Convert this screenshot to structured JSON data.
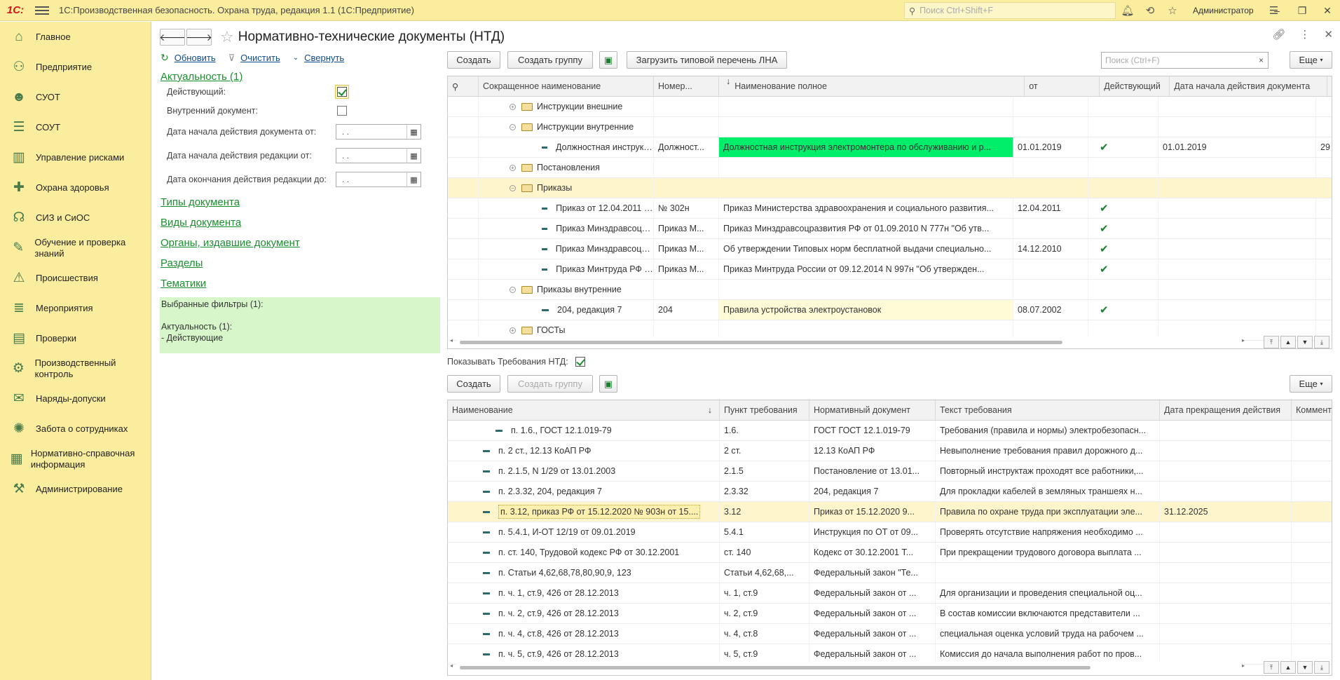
{
  "app": {
    "logo": "1С:",
    "title": "1С:Производственная безопасность. Охрана труда, редакция 1.1  (1С:Предприятие)",
    "search_placeholder": "Поиск Ctrl+Shift+F",
    "user": "Администратор"
  },
  "sidebar": {
    "items": [
      {
        "label": "Главное",
        "icon": "home-icon"
      },
      {
        "label": "Предприятие",
        "icon": "org-icon"
      },
      {
        "label": "СУОТ",
        "icon": "worker-icon"
      },
      {
        "label": "СОУТ",
        "icon": "checklist-icon"
      },
      {
        "label": "Управление рисками",
        "icon": "chart-icon"
      },
      {
        "label": "Охрана здоровья",
        "icon": "cross-icon"
      },
      {
        "label": "СИЗ и СиОС",
        "icon": "headset-icon"
      },
      {
        "label": "Обучение и проверка знаний",
        "icon": "training-icon"
      },
      {
        "label": "Происшествия",
        "icon": "warning-icon"
      },
      {
        "label": "Мероприятия",
        "icon": "list-icon"
      },
      {
        "label": "Проверки",
        "icon": "clipboard-icon"
      },
      {
        "label": "Производственный контроль",
        "icon": "control-icon"
      },
      {
        "label": "Наряды-допуски",
        "icon": "permit-icon"
      },
      {
        "label": "Забота о сотрудниках",
        "icon": "gear-icon"
      },
      {
        "label": "Нормативно-справочная информация",
        "icon": "books-icon"
      },
      {
        "label": "Администрирование",
        "icon": "admin-icon"
      }
    ]
  },
  "page": {
    "title": "Нормативно-технические документы (НТД)"
  },
  "filters": {
    "refresh": "Обновить",
    "clear": "Очистить",
    "collapse": "Свернуть",
    "actuality": "Актуальность (1)",
    "active_label": "Действующий:",
    "internal_label": "Внутренний документ:",
    "date_doc_start": "Дата начала действия документа от:",
    "date_red_start": "Дата начала действия редакции от:",
    "date_red_end": "Дата окончания действия редакции до:",
    "date_placeholder": " .  .",
    "groups": [
      "Типы документа",
      "Виды документа",
      "Органы, издавшие документ",
      "Разделы",
      "Тематики"
    ],
    "selected_title": "Выбранные фильтры (1):",
    "selected_group": "Актуальность (1):",
    "selected_value": "- Действующие"
  },
  "toolbar1": {
    "create": "Создать",
    "create_group": "Создать группу",
    "load": "Загрузить типовой перечень ЛНА",
    "search_placeholder": "Поиск (Ctrl+F)",
    "clear": "×",
    "more": "Еще"
  },
  "docs_table": {
    "headers": [
      "Сокращенное наименование",
      "Номер...",
      "Наименование полное",
      "от",
      "Действующий",
      "Дата начала действия документа",
      "Да"
    ],
    "rows": [
      {
        "type": "group",
        "expanded": false,
        "level": 1,
        "name": "Инструкции внешние",
        "num": "",
        "full": "",
        "date": "",
        "active": "",
        "start": "",
        "extra": ""
      },
      {
        "type": "group",
        "expanded": true,
        "level": 1,
        "name": "Инструкции внутренние",
        "num": "",
        "full": "",
        "date": "",
        "active": "",
        "start": "",
        "extra": ""
      },
      {
        "type": "item",
        "level": 2,
        "name": "Должностная инструкция эл...",
        "num": "Должност...",
        "full": "Должностная инструкция электромонтера по обслуживанию и р...",
        "date": "01.01.2019",
        "active": "✔",
        "start": "01.01.2019",
        "extra": "29",
        "fullcolor": "green"
      },
      {
        "type": "group",
        "expanded": false,
        "level": 1,
        "name": "Постановления",
        "num": "",
        "full": "",
        "date": "",
        "active": "",
        "start": "",
        "extra": ""
      },
      {
        "type": "group",
        "expanded": true,
        "level": 1,
        "name": "Приказы",
        "num": "",
        "full": "",
        "date": "",
        "active": "",
        "start": "",
        "extra": "",
        "selected": true
      },
      {
        "type": "item",
        "level": 2,
        "name": "Приказ от 12.04.2011 № 302н",
        "num": "№ 302н",
        "full": "Приказ Министерства здравоохранения и социального развития...",
        "date": "12.04.2011",
        "active": "✔",
        "start": "",
        "extra": ""
      },
      {
        "type": "item",
        "level": 2,
        "name": " Приказ Минздравсоцразвит...",
        "num": "Приказ М...",
        "full": "Приказ Минздравсоцразвития РФ от 01.09.2010 N 777н \"Об утв...",
        "date": "",
        "active": "✔",
        "start": "",
        "extra": ""
      },
      {
        "type": "item",
        "level": 2,
        "name": "Приказ Минздравсоцразвити...",
        "num": "Приказ М...",
        "full": "Об утверждении Типовых норм бесплатной выдачи специально...",
        "date": "14.12.2010",
        "active": "✔",
        "start": "",
        "extra": ""
      },
      {
        "type": "item",
        "level": 2,
        "name": " Приказ Минтруда РФ N 997...",
        "num": "Приказ М...",
        "full": "Приказ Минтруда России от 09.12.2014 N 997н \"Об утвержден...",
        "date": "",
        "active": "✔",
        "start": "",
        "extra": ""
      },
      {
        "type": "group",
        "expanded": true,
        "level": 1,
        "name": "Приказы внутренние",
        "num": "",
        "full": "",
        "date": "",
        "active": "",
        "start": "",
        "extra": ""
      },
      {
        "type": "item",
        "level": 2,
        "name": "204, редакция 7",
        "num": "204",
        "full": "Правила устройства электроустановок",
        "date": "08.07.2002",
        "active": "✔",
        "start": "",
        "extra": "",
        "fullcolor": "yellow"
      },
      {
        "type": "group",
        "expanded": false,
        "level": 1,
        "name": "ГОСТы",
        "num": "",
        "full": "",
        "date": "",
        "active": "",
        "start": "",
        "extra": ""
      }
    ]
  },
  "show_requirements": {
    "label": "Показывать Требования НТД:"
  },
  "toolbar2": {
    "create": "Создать",
    "create_group": "Создать группу",
    "more": "Еще"
  },
  "req_table": {
    "headers": [
      "Наименование",
      "Пункт требования",
      "Нормативный документ",
      "Текст требования",
      "Дата прекращения действия",
      "Комментар"
    ],
    "rows": [
      {
        "name": " п. 1.6., ГОСТ 12.1.019-79",
        "point": "1.6.",
        "doc": " ГОСТ ГОСТ 12.1.019-79",
        "text": "Требования (правила и нормы) электробезопасн...",
        "end": "",
        "comment": "",
        "indent": true
      },
      {
        "name": "п. 2 ст., 12.13 КоАП РФ",
        "point": "2 ст.",
        "doc": "  12.13 КоАП РФ",
        "text": "Невыполнение требования правил дорожного д...",
        "end": "",
        "comment": ""
      },
      {
        "name": "п. 2.1.5, N 1/29 от 13.01.2003",
        "point": "2.1.5",
        "doc": "Постановление от 13.01...",
        "text": "Повторный инструктаж проходят все работники,...",
        "end": "",
        "comment": ""
      },
      {
        "name": "п. 2.3.32, 204, редакция 7",
        "point": "2.3.32",
        "doc": "204, редакция 7",
        "text": "Для прокладки кабелей в земляных траншеях н...",
        "end": "",
        "comment": ""
      },
      {
        "name": "п. 3.12, приказ РФ от 15.12.2020 № 903н от 15....",
        "point": "3.12",
        "doc": "Приказ от 15.12.2020 9...",
        "text": "Правила по охране труда при эксплуатации эле...",
        "end": "31.12.2025",
        "comment": "",
        "selected": true
      },
      {
        "name": "п. 5.4.1, И-ОТ 12/19 от 09.01.2019",
        "point": "5.4.1",
        "doc": "Инструкция по ОТ от 09...",
        "text": "Проверять отсутствие напряжения необходимо ...",
        "end": "",
        "comment": ""
      },
      {
        "name": "п. ст. 140, Трудовой кодекс РФ от 30.12.2001",
        "point": "ст. 140",
        "doc": "Кодекс от 30.12.2001 Т...",
        "text": "При прекращении трудового договора выплата ...",
        "end": "",
        "comment": ""
      },
      {
        "name": "п. Статьи 4,62,68,78,80,90,9, 123",
        "point": "Статьи 4,62,68,...",
        "doc": "Федеральный закон \"Те...",
        "text": "",
        "end": "",
        "comment": ""
      },
      {
        "name": "п. ч. 1, ст.9, 426 от 28.12.2013",
        "point": "ч. 1, ст.9",
        "doc": "Федеральный закон от ...",
        "text": "Для организации и проведения специальной оц...",
        "end": "",
        "comment": ""
      },
      {
        "name": "п. ч. 2, ст.9, 426 от 28.12.2013",
        "point": "ч. 2, ст.9",
        "doc": "Федеральный закон от ...",
        "text": "В состав комиссии включаются представители ...",
        "end": "",
        "comment": ""
      },
      {
        "name": "п. ч. 4, ст.8, 426 от 28.12.2013",
        "point": "ч. 4, ст.8",
        "doc": "Федеральный закон от ...",
        "text": "специальная оценка условий труда на рабочем ...",
        "end": "",
        "comment": ""
      },
      {
        "name": "п. ч. 5, ст.9, 426 от 28.12.2013",
        "point": "ч. 5, ст.9",
        "doc": "Федеральный закон от ...",
        "text": "Комиссия до начала выполнения работ по пров...",
        "end": "",
        "comment": ""
      }
    ]
  }
}
